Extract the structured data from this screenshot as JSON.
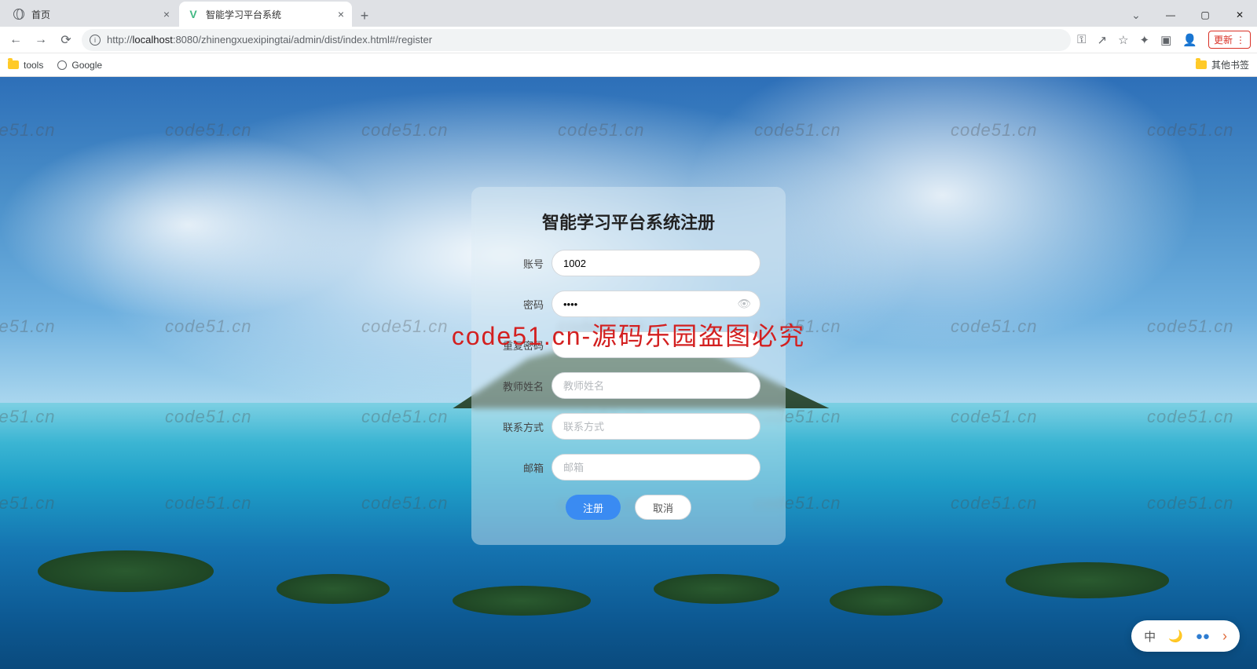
{
  "browser": {
    "tabs": [
      {
        "title": "首页",
        "icon": "globe"
      },
      {
        "title": "智能学习平台系统",
        "icon": "vue"
      }
    ],
    "url_prefix": "http://",
    "url_host": "localhost",
    "url_path": ":8080/zhinengxuexipingtai/admin/dist/index.html#/register",
    "update_label": "更新",
    "bookmarks": {
      "tools": "tools",
      "google": "Google",
      "other": "其他书签"
    }
  },
  "watermark": "code51.cn",
  "overlay": "code51.cn-源码乐园盗图必究",
  "form": {
    "title": "智能学习平台系统注册",
    "fields": {
      "account": {
        "label": "账号",
        "value": "1002"
      },
      "password": {
        "label": "密码",
        "value": "••••"
      },
      "password2": {
        "label": "重复密码",
        "placeholder": ""
      },
      "teacher": {
        "label": "教师姓名",
        "placeholder": "教师姓名"
      },
      "contact": {
        "label": "联系方式",
        "placeholder": "联系方式"
      },
      "email": {
        "label": "邮箱",
        "placeholder": "邮箱"
      }
    },
    "submit": "注册",
    "cancel": "取消"
  },
  "floatbar": {
    "lang": "中"
  }
}
